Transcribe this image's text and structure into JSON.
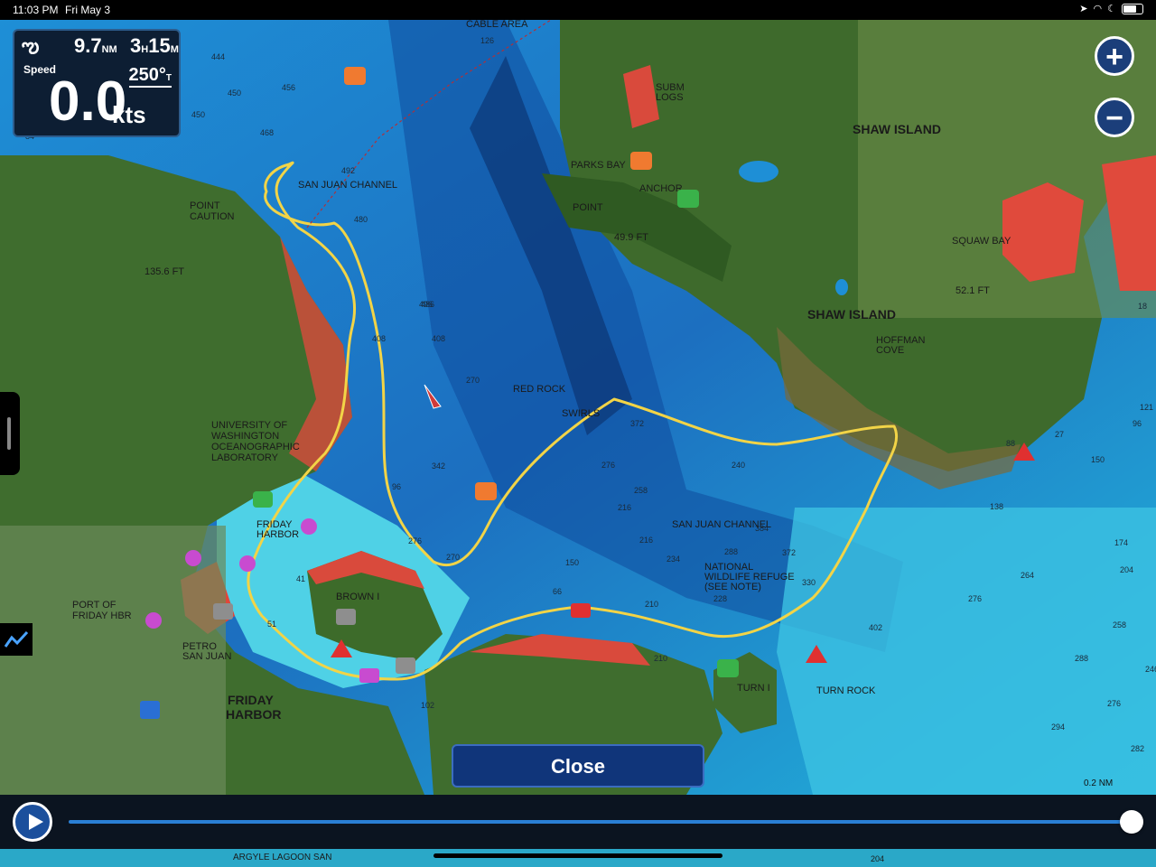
{
  "statusbar": {
    "time": "11:03 PM",
    "date": "Fri May 3"
  },
  "panel": {
    "distance": "9.7",
    "distance_unit": "NM",
    "time_h": "3",
    "time_h_unit": "H",
    "time_m": "15",
    "time_m_unit": "M",
    "speed_label": "Speed",
    "heading": "250°",
    "heading_unit": "T",
    "speed": "0.0",
    "speed_unit": "kts"
  },
  "zoom": {
    "in": "+",
    "out": "−"
  },
  "labels": {
    "shaw_island_top": "SHAW ISLAND",
    "shaw_island": "SHAW ISLAND",
    "san_juan_channel_top": "SAN JUAN CHANNEL",
    "san_juan_channel": "SAN JUAN CHANNEL",
    "parks_bay": "PARKS BAY",
    "anchor": "ANCHOR",
    "point": "POINT",
    "point_caution_1": "POINT",
    "point_caution_2": "CAUTION",
    "squaw_bay": "SQUAW BAY",
    "hoffman_cove_1": "HOFFMAN",
    "hoffman_cove_2": "COVE",
    "university_1": "UNIVERSITY OF",
    "university_2": "WASHINGTON",
    "university_3": "OCEANOGRAPHIC",
    "university_4": "LABORATORY",
    "friday_harbor_small_1": "FRIDAY",
    "friday_harbor_small_2": "HARBOR",
    "port_of_1": "PORT OF",
    "port_of_2": "FRIDAY HBR",
    "petro_1": "PETRO",
    "petro_2": "SAN JUAN",
    "friday_harbor_1": "FRIDAY",
    "friday_harbor_2": "HARBOR",
    "brown_i": "BROWN I",
    "national_1": "NATIONAL",
    "national_2": "WILDLIFE REFUGE",
    "national_3": "(SEE NOTE)",
    "turn_i": "TURN I",
    "turn_rock": "TURN ROCK",
    "swirls": "SWIRLS",
    "red_rock": "RED ROCK",
    "subm_logs_1": "SUBM",
    "subm_logs_2": "LOGS",
    "cable_area": "CABLE AREA",
    "height_1": "135.6 FT",
    "height_2": "49.9 FT",
    "height_3": "52.1 FT"
  },
  "depths": [
    "126",
    "444",
    "450",
    "456",
    "468",
    "450",
    "84",
    "492",
    "480",
    "496",
    "408",
    "486",
    "408",
    "342",
    "270",
    "96",
    "276",
    "372",
    "276",
    "258",
    "216",
    "240",
    "384",
    "372",
    "288",
    "234",
    "216",
    "270",
    "330",
    "228",
    "210",
    "150",
    "264",
    "276",
    "258",
    "402",
    "288",
    "294",
    "276",
    "282",
    "246",
    "210",
    "96",
    "174",
    "204",
    "138",
    "121",
    "150",
    "27",
    "88",
    "18",
    "66",
    "41",
    "51",
    "102"
  ],
  "close_button": "Close",
  "scale": {
    "value": "0.2",
    "unit": "NM"
  },
  "bottom": {
    "label": "ARGYLE LAGOON SAN",
    "num": "204"
  },
  "colors": {
    "track": "#f2d447",
    "panel_bg": "#0d1e33",
    "button": "#10357a",
    "slider": "#2a7fd4"
  }
}
